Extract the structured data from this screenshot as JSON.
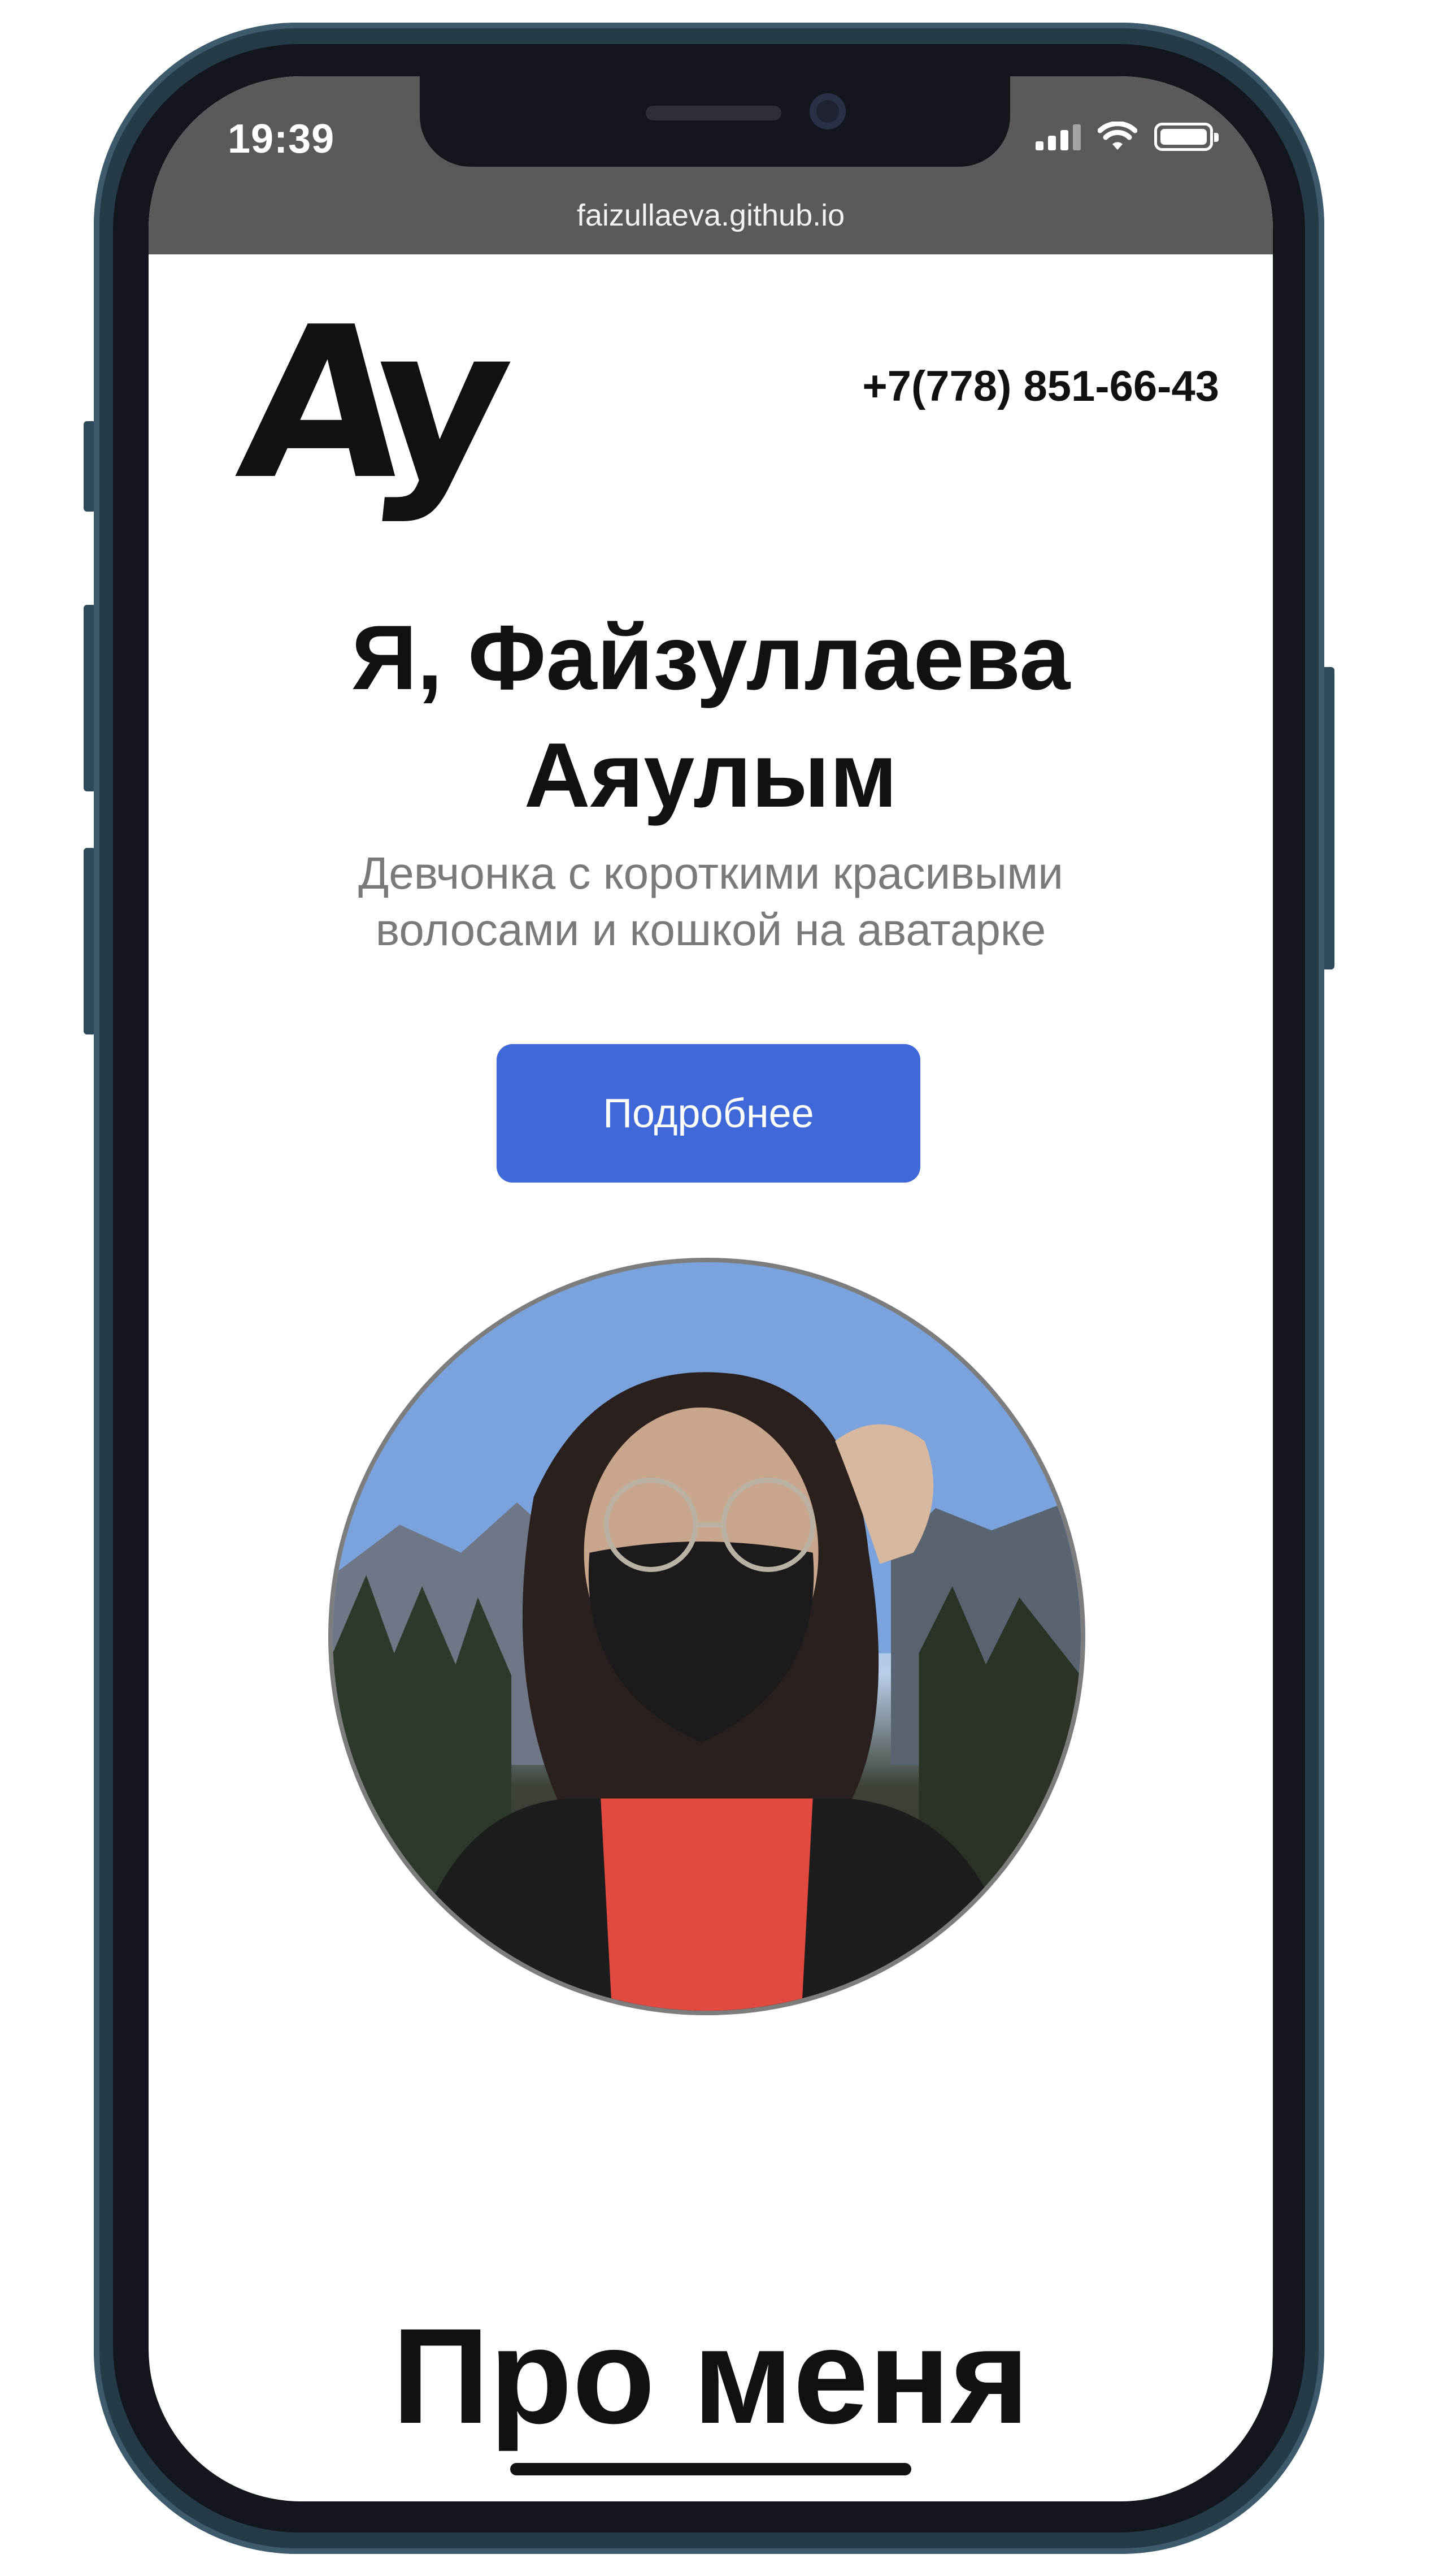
{
  "status_bar": {
    "time": "19:39",
    "url": "faizullaeva.github.io"
  },
  "header": {
    "logo_text": "Ay",
    "phone": "+7(778) 851-66-43"
  },
  "hero": {
    "title_line1": "Я, Файзуллаева",
    "title_line2": "Аяулым",
    "subtitle": "Девчонка с короткими красивыми волосами и кошкой на аватарке",
    "button_label": "Подробнее",
    "avatar_icon": "avatar-photo"
  },
  "section": {
    "title": "Про меня"
  },
  "colors": {
    "accent": "#3f68d8",
    "frame": "#253b48",
    "status_bar": "#5a5a5a"
  }
}
